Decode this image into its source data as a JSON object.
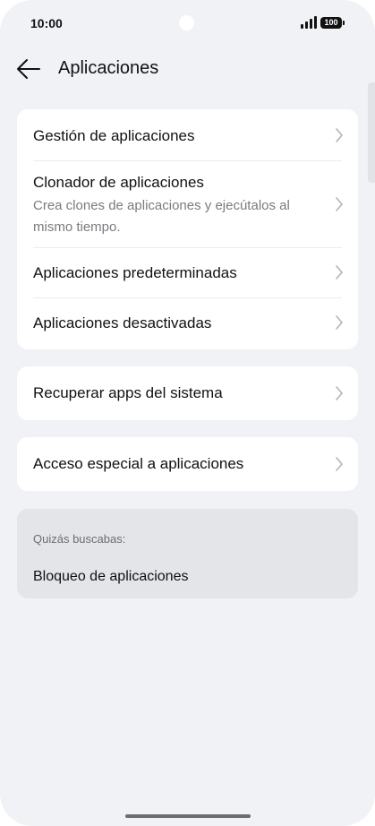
{
  "status_bar": {
    "time": "10:00",
    "battery": "100",
    "signal_icon": "signal-bars-icon",
    "camera_icon": "front-camera-icon"
  },
  "header": {
    "back_icon": "arrow-left-icon",
    "title": "Aplicaciones"
  },
  "groups": [
    {
      "items": [
        {
          "label": "Gestión de aplicaciones"
        },
        {
          "label": "Clonador de aplicaciones",
          "description": "Crea clones de aplicaciones y ejecútalos al mismo tiempo."
        },
        {
          "label": "Aplicaciones predeterminadas"
        },
        {
          "label": "Aplicaciones desactivadas"
        }
      ]
    },
    {
      "items": [
        {
          "label": "Recuperar apps del sistema"
        }
      ]
    },
    {
      "items": [
        {
          "label": "Acceso especial a aplicaciones"
        }
      ]
    }
  ],
  "suggestions": {
    "caption": "Quizás buscabas:",
    "items": [
      {
        "label": "Bloqueo de aplicaciones"
      }
    ]
  },
  "chevron_icon": "chevron-right-icon",
  "colors": {
    "background": "#f1f2f6",
    "card": "#ffffff",
    "suggestion_card": "#e4e5e9",
    "text_primary": "#111111",
    "text_secondary": "#7a7b80"
  }
}
